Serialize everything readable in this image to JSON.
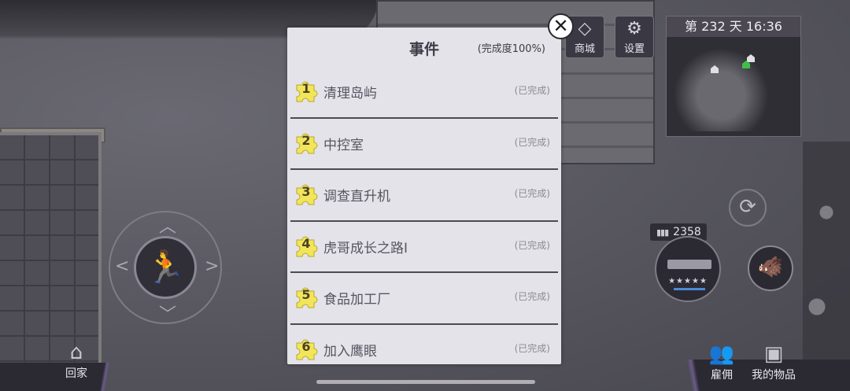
{
  "hud": {
    "shop_label": "商城",
    "settings_label": "设置",
    "day_time": "第 232 天   16:36",
    "ammo_count": "2358",
    "weapon_stars": "★★★★★",
    "home_label": "回家",
    "hire_label": "雇佣",
    "items_label": "我的物品",
    "icons": {
      "shop": "diamond-icon",
      "settings": "gear-icon",
      "run": "running-man-icon",
      "reload": "refresh-icon",
      "pet": "beast-icon",
      "home": "house-icon",
      "hire": "group-icon",
      "items": "chest-icon",
      "close": "close-icon"
    }
  },
  "modal": {
    "title": "事件",
    "progress": "(完成度100%)",
    "close_symbol": "✕",
    "events": [
      {
        "num": "1",
        "name": "清理岛屿",
        "status": "(已完成)"
      },
      {
        "num": "2",
        "name": "中控室",
        "status": "(已完成)"
      },
      {
        "num": "3",
        "name": "调查直升机",
        "status": "(已完成)"
      },
      {
        "num": "4",
        "name": "虎哥成长之路I",
        "status": "(已完成)"
      },
      {
        "num": "5",
        "name": "食品加工厂",
        "status": "(已完成)"
      },
      {
        "num": "6",
        "name": "加入鹰眼",
        "status": "(已完成)"
      }
    ]
  },
  "colors": {
    "modal_bg": "#e4e3ea",
    "puzzle_yellow": "#f2e55a",
    "divider": "#4d4a55",
    "minimap_player": "#3fbf4a"
  }
}
